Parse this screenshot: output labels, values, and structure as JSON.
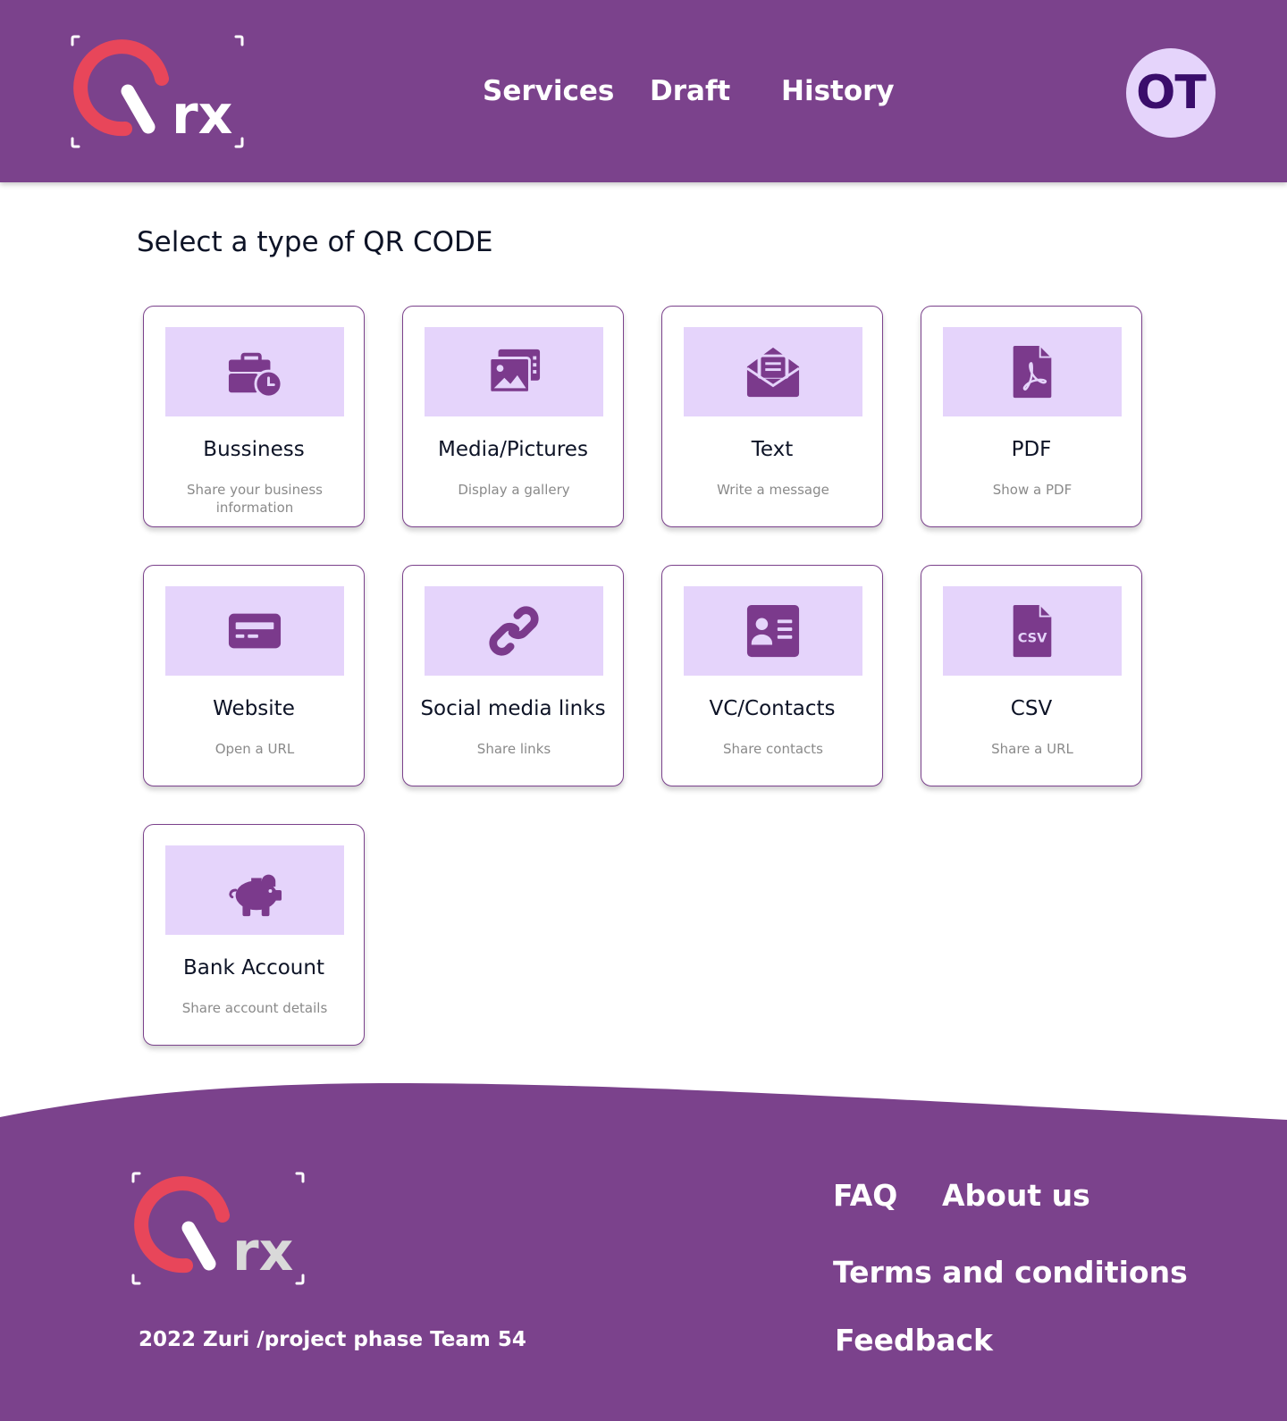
{
  "header": {
    "logo_text": "rx",
    "nav": [
      {
        "label": "Services"
      },
      {
        "label": "Draft"
      },
      {
        "label": "History"
      }
    ],
    "avatar_initials": "OT"
  },
  "main": {
    "title": "Select a type of QR CODE",
    "cards": [
      {
        "title": "Bussiness",
        "description": "Share your business information",
        "icon": "briefcase-clock-icon"
      },
      {
        "title": "Media/Pictures",
        "description": "Display a gallery",
        "icon": "photo-gallery-icon"
      },
      {
        "title": "Text",
        "description": "Write a message",
        "icon": "open-envelope-icon"
      },
      {
        "title": "PDF",
        "description": "Show a PDF",
        "icon": "pdf-file-icon"
      },
      {
        "title": "Website",
        "description": "Open a URL",
        "icon": "card-icon"
      },
      {
        "title": "Social media links",
        "description": "Share links",
        "icon": "link-icon"
      },
      {
        "title": "VC/Contacts",
        "description": "Share contacts",
        "icon": "contact-card-icon"
      },
      {
        "title": "CSV",
        "description": "Share a URL",
        "icon": "csv-file-icon"
      },
      {
        "title": "Bank Account",
        "description": "Share account details",
        "icon": "piggy-bank-icon"
      }
    ]
  },
  "footer": {
    "logo_text": "rx",
    "links": [
      {
        "label": "FAQ"
      },
      {
        "label": "About us"
      },
      {
        "label": "Terms and conditions"
      },
      {
        "label": "Feedback"
      }
    ],
    "copyright": "2022 Zuri /project phase Team 54"
  },
  "colors": {
    "brand_purple": "#7b428c",
    "light_lavender": "#e5d4fb",
    "logo_red": "#e8465a",
    "icon_purple": "#7b3a8c"
  }
}
